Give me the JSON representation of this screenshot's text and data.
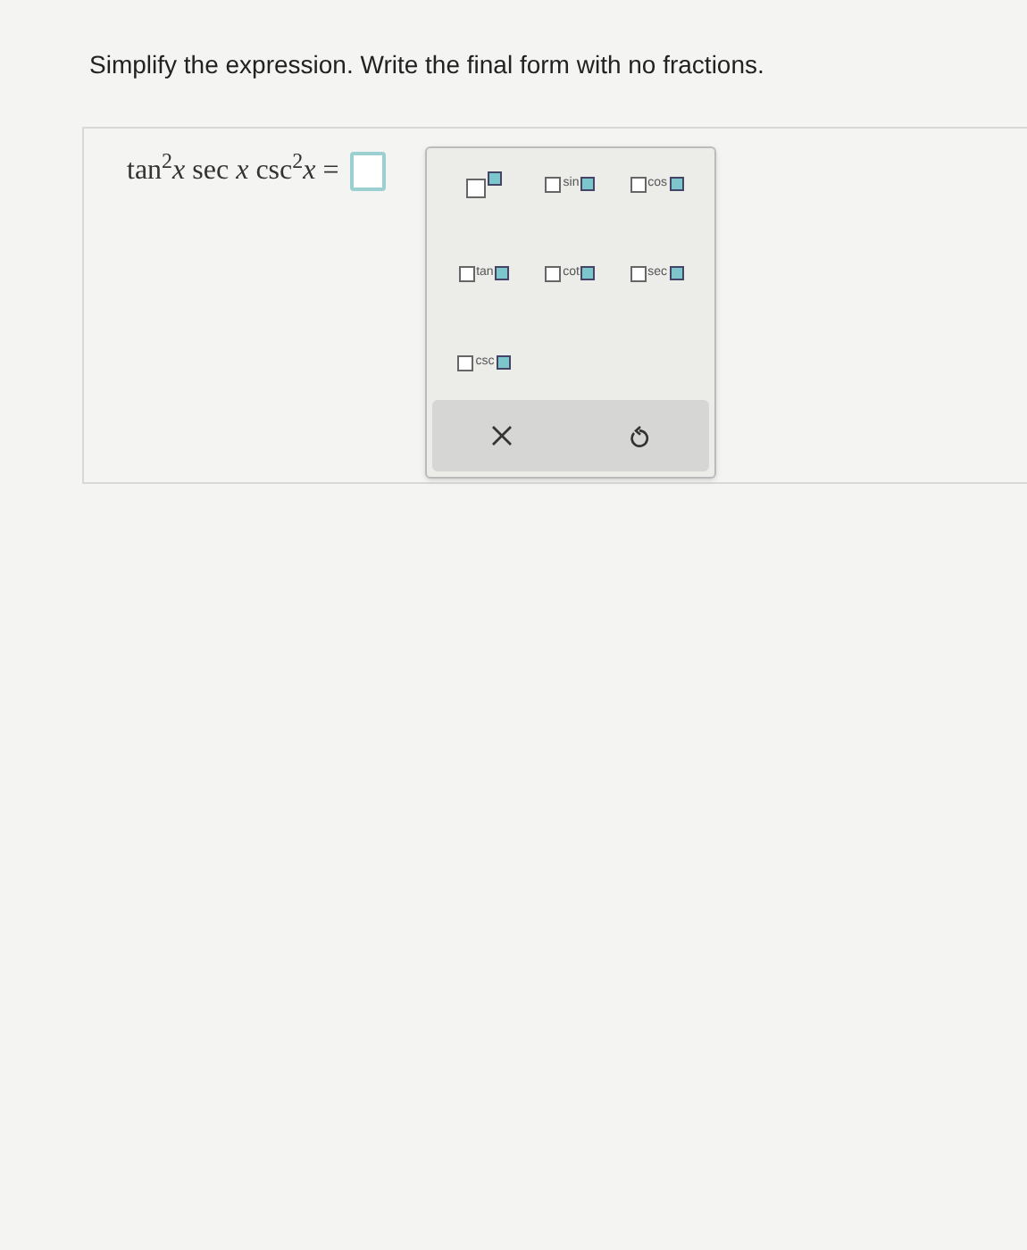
{
  "instruction": "Simplify the expression. Write the final form with no fractions.",
  "equation": "tan$^{2}$*x* sec *x* csc$^{2}$*x* =",
  "templates": [
    {
      "kind": "power"
    },
    {
      "kind": "function",
      "label": "sin"
    },
    {
      "kind": "function",
      "label": "cos"
    },
    {
      "kind": "function",
      "label": "tan"
    },
    {
      "kind": "function",
      "label": "cot"
    },
    {
      "kind": "function",
      "label": "sec"
    },
    {
      "kind": "function",
      "label": "csc"
    }
  ],
  "actions": [
    {
      "kind": "clear"
    },
    {
      "kind": "undo"
    }
  ]
}
